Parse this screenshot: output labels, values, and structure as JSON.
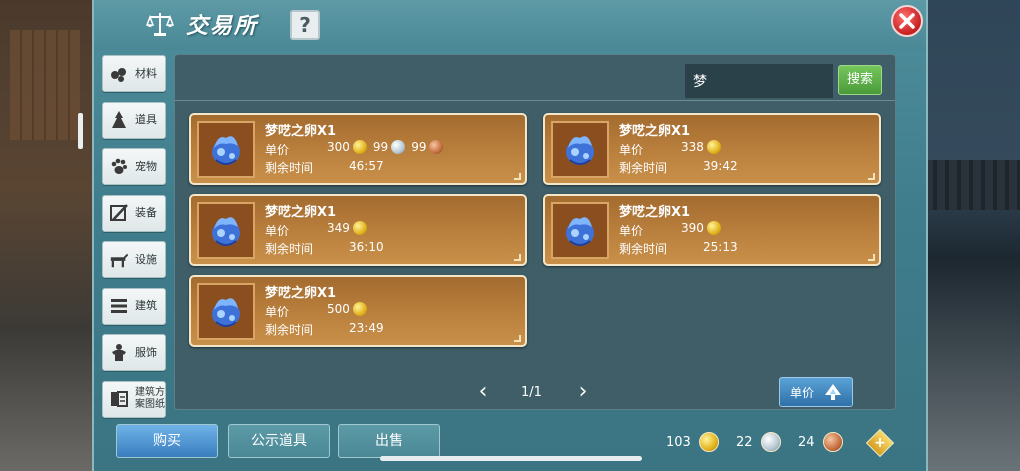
{
  "window": {
    "title": "交易所",
    "help_label": "?",
    "close_icon": "close-x-icon"
  },
  "sidebar": {
    "items": [
      {
        "label": "材料",
        "icon": "material-icon"
      },
      {
        "label": "道具",
        "icon": "item-icon"
      },
      {
        "label": "宠物",
        "icon": "pet-paw-icon"
      },
      {
        "label": "装备",
        "icon": "equipment-icon"
      },
      {
        "label": "设施",
        "icon": "facility-icon"
      },
      {
        "label": "建筑",
        "icon": "building-icon"
      },
      {
        "label": "服饰",
        "icon": "clothing-icon"
      },
      {
        "label": "建筑方\n案图纸",
        "icon": "blueprint-icon"
      }
    ]
  },
  "search": {
    "value": "梦",
    "button_label": "搜索"
  },
  "listing_labels": {
    "price": "单价",
    "time": "剩余时间"
  },
  "listings": [
    {
      "name": "梦呓之卵X1",
      "prices": [
        {
          "amount": "300",
          "coin": "gold"
        },
        {
          "amount": "99",
          "coin": "silver"
        },
        {
          "amount": "99",
          "coin": "bronze"
        }
      ],
      "time": "46:57"
    },
    {
      "name": "梦呓之卵X1",
      "prices": [
        {
          "amount": "338",
          "coin": "gold"
        }
      ],
      "time": "39:42"
    },
    {
      "name": "梦呓之卵X1",
      "prices": [
        {
          "amount": "349",
          "coin": "gold"
        }
      ],
      "time": "36:10"
    },
    {
      "name": "梦呓之卵X1",
      "prices": [
        {
          "amount": "390",
          "coin": "gold"
        }
      ],
      "time": "25:13"
    },
    {
      "name": "梦呓之卵X1",
      "prices": [
        {
          "amount": "500",
          "coin": "gold"
        }
      ],
      "time": "23:49"
    }
  ],
  "pager": {
    "text": "1/1"
  },
  "sort": {
    "label": "单价"
  },
  "bottom_tabs": {
    "buy": "购买",
    "public": "公示道具",
    "sell": "出售"
  },
  "currency": {
    "gold": "103",
    "silver": "22",
    "bronze": "24"
  },
  "colors": {
    "gold_coin": "#e2b31d",
    "silver_coin": "#b6c7d3",
    "bronze_coin": "#c56e3f",
    "search_button": "#5fb24a",
    "buy_tab_active": "#4f94d2"
  }
}
